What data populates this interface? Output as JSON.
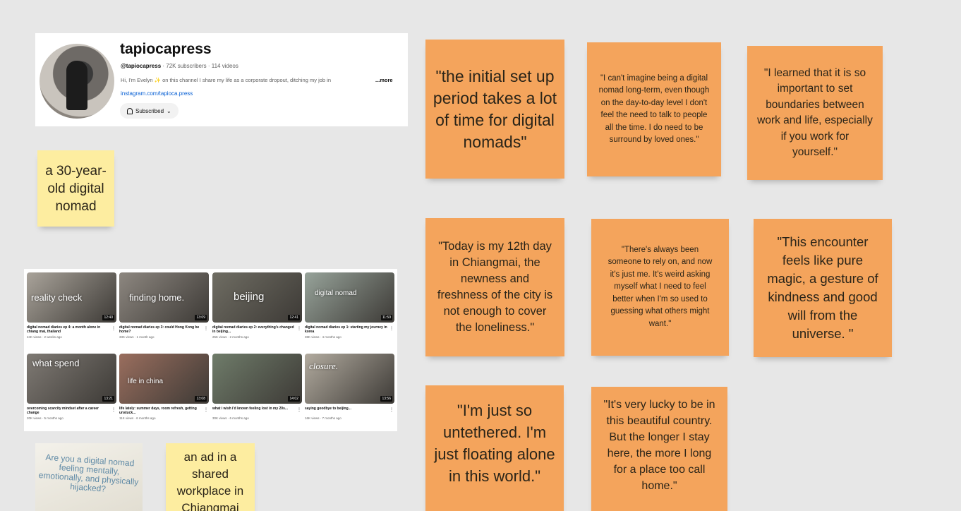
{
  "channel": {
    "name": "tapiocapress",
    "handle": "@tapiocapress",
    "stats": " · 72K subscribers · 114 videos",
    "description": "Hi, I'm Evelyn ✨ on this channel I share my life as a corporate dropout, ditching my job in",
    "more": "...more",
    "link": "instagram.com/tapioca.press",
    "subscribed_label": "Subscribed"
  },
  "notes": {
    "profile": "a 30-year-old digital nomad",
    "ad": "an ad in a shared workplace in Chiangmai",
    "quotes": [
      "\"the initial set up period takes a lot of time for digital nomads\"",
      "\"I can't imagine being a digital nomad long-term, even though on the day-to-day level I don't feel the need to talk to people all the time. I do need to be surround by loved ones.\"",
      "\"I  learned that it is so important to set boundaries between work and life, especially if you work for yourself.\"",
      "\"Today is my 12th day in Chiangmai, the newness and freshness of the city is not enough to cover the loneliness.\"",
      "\"There's always been someone to rely on, and now it's just me. It's weird asking myself what I need to feel better when I'm so used to guessing what others might want.\"",
      "\"This encounter feels like pure magic, a gesture of kindness and good will from the universe. \"",
      "\"I'm just so untethered. I'm just floating alone in this world.\"",
      "\"It's very lucky to be in this beautiful country. But the longer I stay here, the more I long for a place too call home.\""
    ]
  },
  "ad_photo_text": "Are you a digital nomad feeling mentally, emotionally, and physically hijacked?",
  "videos": [
    {
      "overlay": "reality     check",
      "title": "digital nomad diaries ep 4: a month alone in chiang mai, thailand",
      "meta": "24K views · 2 weeks ago",
      "duration": "12:40",
      "color": "#a9a39a"
    },
    {
      "overlay": "finding      home.",
      "title": "digital nomad diaries ep 3: could Hong Kong be home?",
      "meta": "33K views · 1 month ago",
      "duration": "13:09",
      "color": "#8d8780"
    },
    {
      "overlay": "beijing",
      "title": "digital nomad diaries ep 2: everything's changed in beijing...",
      "meta": "25K views · 2 months ago",
      "duration": "12:41",
      "color": "#6f6d63"
    },
    {
      "overlay": "digital     nomad",
      "title": "digital nomad diaries ep 1: starting my journey in korea",
      "meta": "38K views · 4 months ago",
      "duration": "11:59",
      "color": "#97a39a"
    },
    {
      "overlay": "what     spend",
      "title": "overcoming scarcity mindset after a career change",
      "meta": "20K views · 5 months ago",
      "duration": "13:21",
      "color": "#7f7a74"
    },
    {
      "overlay": "life        in china",
      "title": "life lately: summer days, room refresh, getting unstuck...",
      "meta": "11K views · 6 months ago",
      "duration": "13:08",
      "color": "#9a6e5e"
    },
    {
      "overlay": "",
      "title": "what i wish i'd known feeling lost in my 20s...",
      "meta": "30K views · 6 months ago",
      "duration": "14:02",
      "color": "#6f7c6a"
    },
    {
      "overlay": "closure.",
      "title": "saying goodbye to beijing...",
      "meta": "16K views · 7 months ago",
      "duration": "13:56",
      "color": "#b2ab9f"
    }
  ]
}
